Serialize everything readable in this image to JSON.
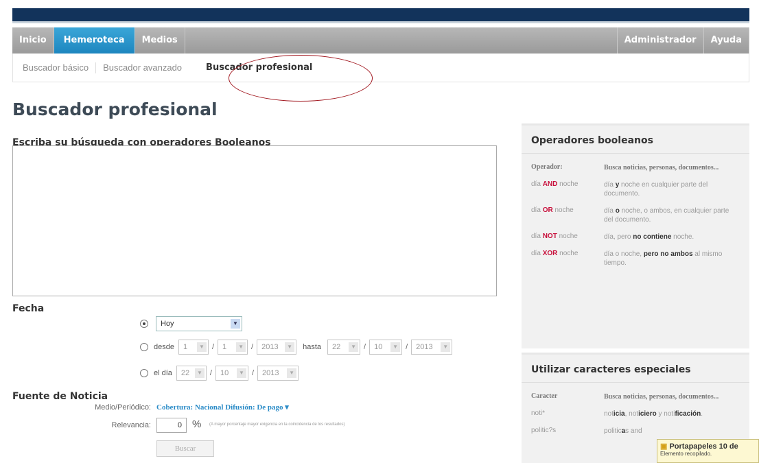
{
  "nav": {
    "items": [
      {
        "label": "Inicio"
      },
      {
        "label": "Hemeroteca"
      },
      {
        "label": "Medios"
      }
    ],
    "right": [
      {
        "label": "Administrador"
      },
      {
        "label": "Ayuda"
      }
    ]
  },
  "subnav": {
    "items": [
      {
        "label": "Buscador básico"
      },
      {
        "label": "Buscador avanzado"
      },
      {
        "label": "Buscador profesional"
      }
    ]
  },
  "page": {
    "title": "Buscador profesional",
    "query_label": "Escriba su búsqueda con operadores Booleanos"
  },
  "fecha": {
    "label": "Fecha",
    "preset": "Hoy",
    "desde_label": "desde",
    "hasta_label": "hasta",
    "desde": {
      "d": "1",
      "m": "1",
      "y": "2013"
    },
    "hasta": {
      "d": "22",
      "m": "10",
      "y": "2013"
    },
    "dia_label": "el día",
    "dia": {
      "d": "22",
      "m": "10",
      "y": "2013"
    },
    "sep": "/"
  },
  "fuente": {
    "label": "Fuente de Noticia",
    "medio_label": "Medio/Periódico:",
    "medio_value": "Cobertura: Nacional Difusión: De pago ▾",
    "relevancia_label": "Relevancia:",
    "relevancia_value": "0",
    "pct": "%",
    "relevancia_note": "(A mayor porcentaje mayor exigencia en la coincidencia de los resultados)",
    "buscar": "Buscar"
  },
  "panel_ops": {
    "title": "Operadores booleanos",
    "head_c1": "Operador:",
    "head_c2": "Busca noticias, personas, documentos...",
    "rows": [
      {
        "a": "día",
        "op": "AND",
        "b": "noche",
        "d1": "día",
        "dop": "y",
        "d2": "noche en cualquier parte del documento."
      },
      {
        "a": "día",
        "op": "OR",
        "b": "noche",
        "d1": "día",
        "dop": "o",
        "d2": "noche, o ambos, en cualquier parte del documento."
      },
      {
        "a": "día",
        "op": "NOT",
        "b": "noche",
        "d1": "día, pero",
        "dop": "no contiene",
        "d2": "noche."
      },
      {
        "a": "día",
        "op": "XOR",
        "b": "noche",
        "d1": "día o noche,",
        "dop": "pero no ambos",
        "d2": "al mismo tiempo."
      }
    ]
  },
  "panel_chars": {
    "title": "Utilizar caracteres especiales",
    "head_c1": "Caracter",
    "head_c2": "Busca noticias, personas, documentos...",
    "rows": [
      {
        "c": "noti*",
        "pre": "not",
        "bold": "icia",
        "mid": ", not",
        "bold2": "iciero",
        "post": " y noti",
        "bold3": "ficación",
        "end": "."
      },
      {
        "c": "politic?s",
        "pre": "politic",
        "bold": "a",
        "mid": "s and",
        "bold2": "",
        "post": "",
        "bold3": "",
        "end": ""
      }
    ]
  },
  "toast": {
    "title": "Portapapeles 10 de",
    "body": "Elemento recopilado."
  }
}
